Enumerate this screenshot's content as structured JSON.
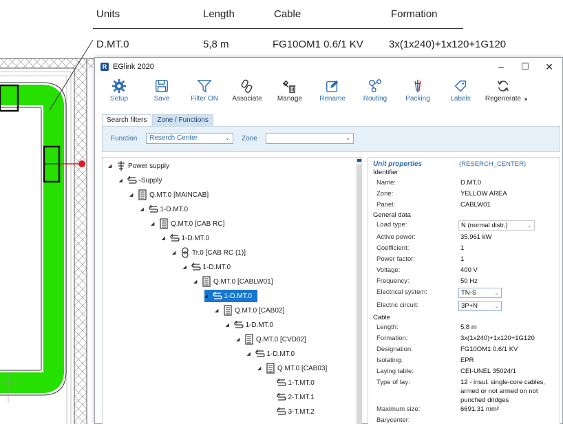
{
  "schedule": {
    "headers": [
      "Units",
      "Length",
      "Cable",
      "Formation"
    ],
    "row": [
      "D.MT.0",
      "5,8 m",
      "FG10OM1 0.6/1 KV",
      "3x(1x240)+1x120+1G120"
    ]
  },
  "window": {
    "title": "EGlink 2020",
    "logo_letter": "R",
    "controls": [
      "–",
      "☐",
      "✕"
    ]
  },
  "toolbar": [
    {
      "label": "Setup",
      "icon": "gear-icon"
    },
    {
      "label": "Save",
      "icon": "save-icon"
    },
    {
      "label": "Filter ON",
      "icon": "filter-icon"
    },
    {
      "label": "Associate",
      "icon": "link-icon"
    },
    {
      "label": "Manage",
      "icon": "manage-icon"
    },
    {
      "label": "Rename",
      "icon": "rename-icon"
    },
    {
      "label": "Routing",
      "icon": "routing-icon"
    },
    {
      "label": "Packing",
      "icon": "packing-icon"
    },
    {
      "label": "Labels",
      "icon": "labels-icon"
    },
    {
      "label": "Regenerate",
      "icon": "regenerate-icon"
    }
  ],
  "tabs": [
    "Search filters",
    "Zone / Functions"
  ],
  "filters": {
    "function_label": "Function",
    "function_value": "Reserch Center",
    "zone_label": "Zone",
    "zone_value": ""
  },
  "tree": [
    {
      "label": "Power supply",
      "level": 0,
      "icon": "power-supply-icon"
    },
    {
      "label": "-Supply",
      "level": 1,
      "icon": "circuit-icon"
    },
    {
      "label": "Q.MT.0 [MAINCAB]",
      "level": 2,
      "icon": "panel-icon"
    },
    {
      "label": "1-D.MT.0",
      "level": 3,
      "icon": "circuit-icon"
    },
    {
      "label": "Q.MT.0 [CAB RC]",
      "level": 4,
      "icon": "panel-icon"
    },
    {
      "label": "1-D.MT.0",
      "level": 5,
      "icon": "circuit-icon"
    },
    {
      "label": "Tr.0 [CAB RC (1)]",
      "level": 6,
      "icon": "transformer-icon"
    },
    {
      "label": "1-D.MT.0",
      "level": 7,
      "icon": "circuit-icon"
    },
    {
      "label": "Q.MT.0 [CABLW01]",
      "level": 8,
      "icon": "panel-icon"
    },
    {
      "label": "1-D.MT.0",
      "level": 9,
      "icon": "circuit-icon",
      "selected": true
    },
    {
      "label": "Q.MT.0 [CAB02]",
      "level": 10,
      "icon": "panel-icon"
    },
    {
      "label": "1-D.MT.0",
      "level": 11,
      "icon": "circuit-icon"
    },
    {
      "label": "Q.MT.0 [CVD02]",
      "level": 12,
      "icon": "panel-icon"
    },
    {
      "label": "1-D.MT.0",
      "level": 13,
      "icon": "circuit-icon"
    },
    {
      "label": "Q.MT.0 [CAB03]",
      "level": 14,
      "icon": "panel-icon"
    },
    {
      "label": "1-T.MT.0",
      "level": 15,
      "icon": "circuit-icon"
    },
    {
      "label": "2-T.MT.1",
      "level": 15,
      "icon": "circuit-icon"
    },
    {
      "label": "3-T.MT.2",
      "level": 15,
      "icon": "circuit-icon"
    }
  ],
  "properties": {
    "title": "Unit properties",
    "subtitle": "(RESERCH_CENTER)",
    "sections": {
      "identifier": "Identifier",
      "general": "General data",
      "cable": "Cable"
    },
    "name_label": "Name:",
    "name": "D.MT.0",
    "zone_label": "Zone:",
    "zone": "YELLOW AREA",
    "panel_label": "Panel:",
    "panel": "CABLW01",
    "load_type_label": "Load type:",
    "load_type": "N (normal distr.)",
    "active_power_label": "Active power:",
    "active_power": "35,961 kW",
    "coefficient_label": "Coefficient:",
    "coefficient": "1",
    "power_factor_label": "Power factor:",
    "power_factor": "1",
    "voltage_label": "Voltage:",
    "voltage": "400 V",
    "frequency_label": "Frequency:",
    "frequency": "50 Hz",
    "electrical_system_label": "Electrical system:",
    "electrical_system": "TN-S",
    "electric_circuit_label": "Electric circuit:",
    "electric_circuit": "3P+N",
    "length_label": "Length:",
    "length": "5,8 m",
    "formation_label": "Formation:",
    "formation": "3x(1x240)+1x120+1G120",
    "designation_label": "Designation:",
    "designation": "FG10OM1 0.6/1 KV",
    "isolating_label": "Isolating:",
    "isolating": "EPR",
    "laying_table_label": "Laying table:",
    "laying_table": "CEI-UNEL 35024/1",
    "type_of_lay_label": "Type of lay:",
    "type_of_lay_lines": [
      "12 - insul. single-core cables,",
      "armed or not armed on not",
      "punched dridges"
    ],
    "maximum_size_label": "Maximum size:",
    "maximum_size": "6691,31 mm²",
    "barycenter_label": "Barycenter:"
  },
  "colors": {
    "accent": "#2d6db5",
    "selection": "#1677d2",
    "cable_route": "#26e000",
    "marker": "#e01b24"
  }
}
